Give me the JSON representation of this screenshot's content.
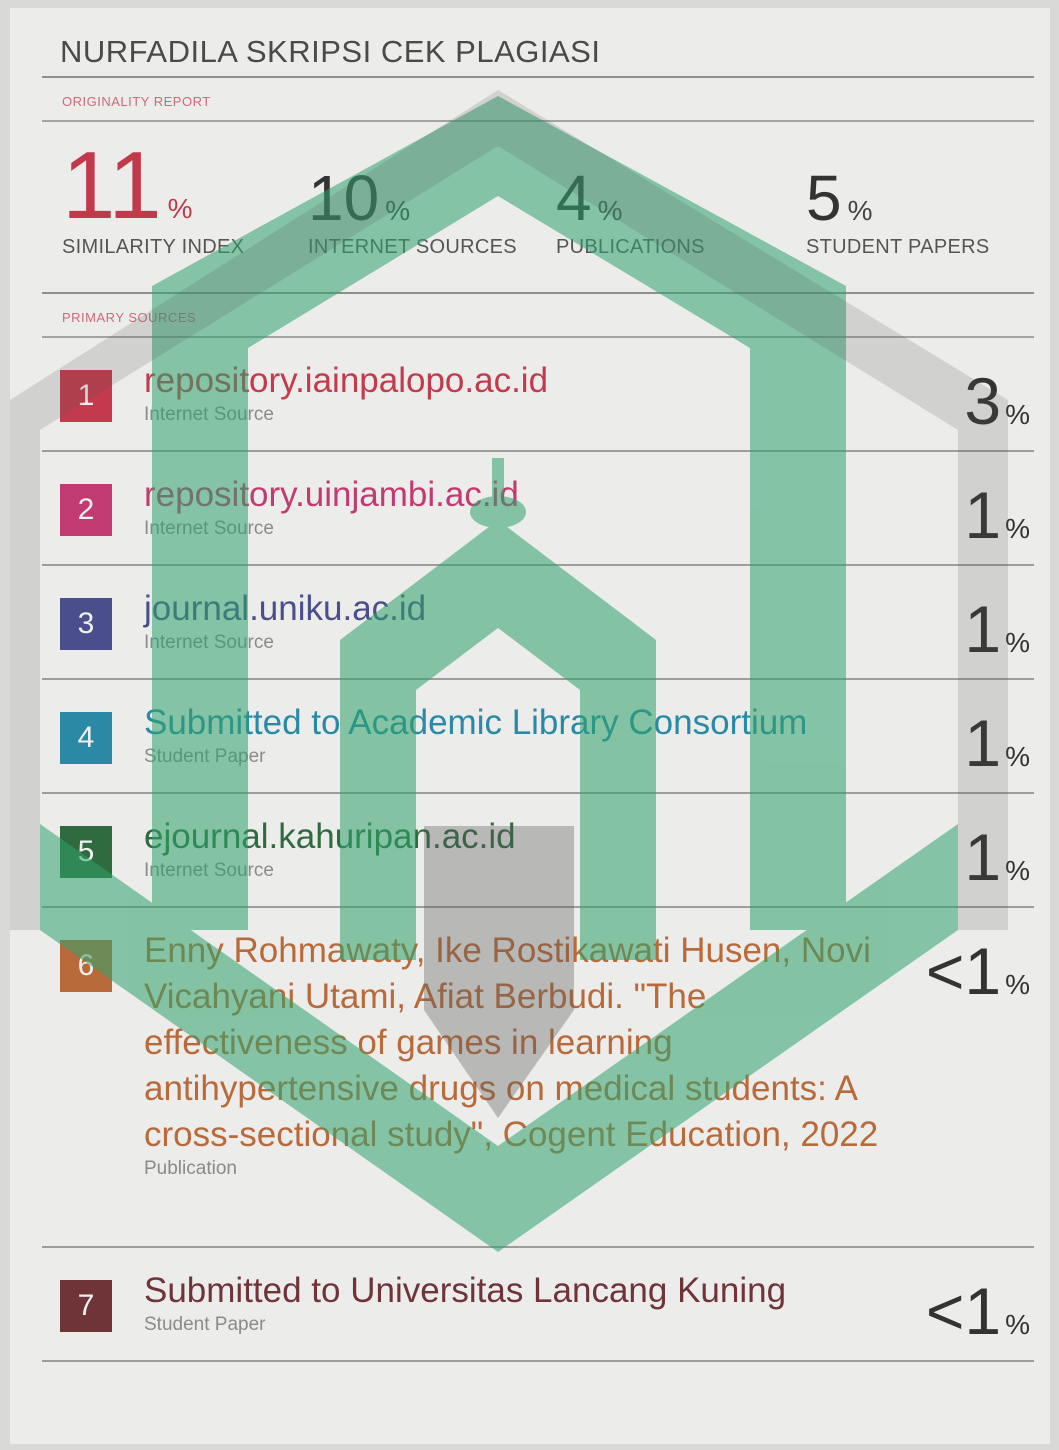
{
  "document": {
    "title": "NURFADILA SKRIPSI CEK PLAGIASI",
    "originality_label": "ORIGINALITY REPORT",
    "primary_sources_label": "PRIMARY SOURCES"
  },
  "stats": [
    {
      "value": "11",
      "unit": "%",
      "label": "SIMILARITY INDEX"
    },
    {
      "value": "10",
      "unit": "%",
      "label": "INTERNET SOURCES"
    },
    {
      "value": "4",
      "unit": "%",
      "label": "PUBLICATIONS"
    },
    {
      "value": "5",
      "unit": "%",
      "label": "STUDENT PAPERS"
    }
  ],
  "sources": [
    {
      "rank": "1",
      "title": "repository.iainpalopo.ac.id",
      "type": "Internet Source",
      "percent": "3",
      "unit": "%",
      "color": "#c23a4b"
    },
    {
      "rank": "2",
      "title": "repository.uinjambi.ac.id",
      "type": "Internet Source",
      "percent": "1",
      "unit": "%",
      "color": "#c23a72"
    },
    {
      "rank": "3",
      "title": "journal.uniku.ac.id",
      "type": "Internet Source",
      "percent": "1",
      "unit": "%",
      "color": "#4a4f8c"
    },
    {
      "rank": "4",
      "title": "Submitted to Academic Library Consortium",
      "type": "Student Paper",
      "percent": "1",
      "unit": "%",
      "color": "#2a8aa6"
    },
    {
      "rank": "5",
      "title": "ejournal.kahuripan.ac.id",
      "type": "Internet Source",
      "percent": "1",
      "unit": "%",
      "color": "#2f6b3f"
    },
    {
      "rank": "6",
      "title": "Enny Rohmawaty, Ike Rostikawati Husen, Novi Vicahyani Utami, Afiat Berbudi. \"The effectiveness of games in learning antihypertensive drugs on medical students: A cross-sectional study\", Cogent Education, 2022",
      "type": "Publication",
      "percent": "<1",
      "unit": "%",
      "color": "#b86a3a"
    },
    {
      "rank": "7",
      "title": "Submitted to Universitas Lancang Kuning",
      "type": "Student Paper",
      "percent": "<1",
      "unit": "%",
      "color": "#6e3438"
    }
  ],
  "colors": {
    "watermark": "#2fa36b",
    "similarity": "#c2394c"
  }
}
